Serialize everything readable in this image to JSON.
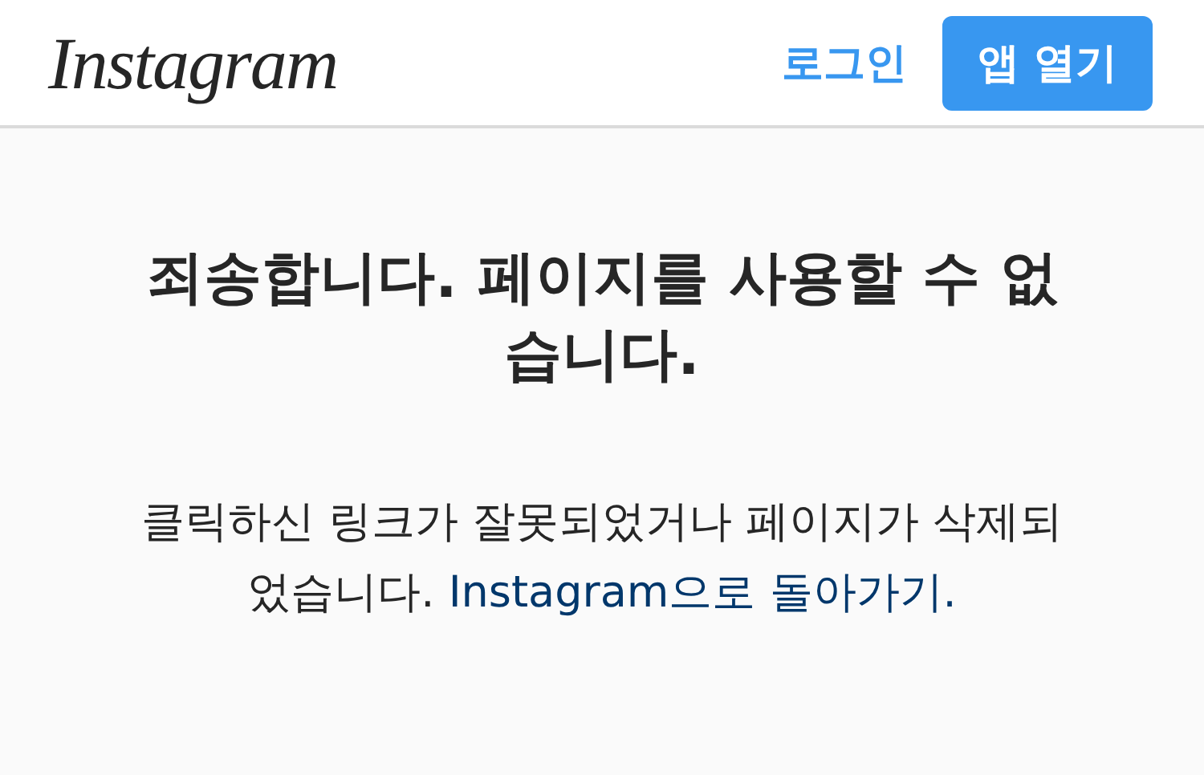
{
  "header": {
    "logo": "Instagram",
    "login_link": "로그인",
    "open_app_button": "앱 열기"
  },
  "heading": "죄송합니다. 페이지를 사용할 수 없습니다.",
  "message": {
    "text": "클릭하신 링크가 잘못되었거나 페이지가 삭제되었습니다.",
    "link": "Instagram으로 돌아가기."
  }
}
